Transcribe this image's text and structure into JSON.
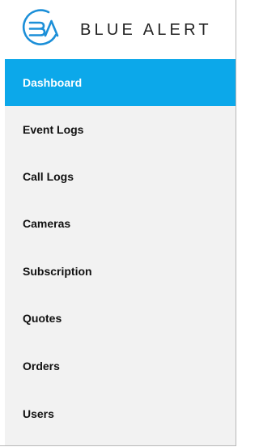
{
  "brand": {
    "logo_icon": "blue-alert-logo-icon",
    "name": "BLUE ALERT",
    "color": "#1c8fd8"
  },
  "nav": {
    "active_color": "#0ca8ea",
    "items": [
      {
        "label": "Dashboard",
        "active": true
      },
      {
        "label": "Event Logs",
        "active": false
      },
      {
        "label": "Call Logs",
        "active": false
      },
      {
        "label": "Cameras",
        "active": false
      },
      {
        "label": "Subscription",
        "active": false
      },
      {
        "label": "Quotes",
        "active": false
      },
      {
        "label": "Orders",
        "active": false
      },
      {
        "label": "Users",
        "active": false
      }
    ]
  }
}
